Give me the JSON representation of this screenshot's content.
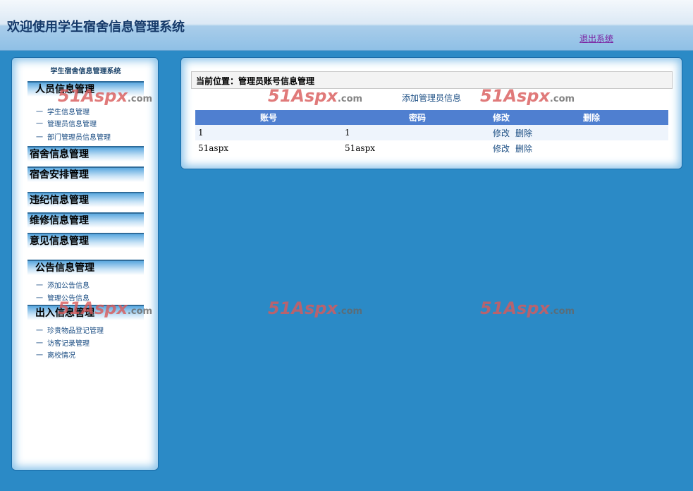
{
  "header": {
    "title": "欢迎使用学生宿舍信息管理系统",
    "logout": "退出系统"
  },
  "sidebar": {
    "title": "学生宿舍信息管理系统",
    "groups": [
      {
        "label": "人员信息管理",
        "items": [
          "学生信息管理",
          "管理员信息管理",
          "部门管理员信息管理"
        ]
      },
      {
        "label": "宿舍信息管理"
      },
      {
        "label": "宿舍安排管理"
      },
      {
        "label": "违纪信息管理"
      },
      {
        "label": "维修信息管理"
      },
      {
        "label": "意见信息管理"
      },
      {
        "label": "公告信息管理",
        "items": [
          "添加公告信息",
          "管理公告信息"
        ]
      },
      {
        "label": "出入信息管理",
        "items": [
          "珍贵物品登记管理",
          "访客记录管理",
          "离校情况"
        ]
      }
    ],
    "dash": "一"
  },
  "main": {
    "breadcrumb": "当前位置：管理员账号信息管理",
    "add_link": "添加管理员信息",
    "table": {
      "headers": [
        "账号",
        "密码",
        "修改",
        "删除"
      ],
      "rows": [
        {
          "account": "1",
          "password": "1",
          "edit": "修改",
          "delete": "删除"
        },
        {
          "account": "51aspx",
          "password": "51aspx",
          "edit": "修改",
          "delete": "删除"
        }
      ]
    }
  },
  "watermark": {
    "main": "51Aspx",
    "suffix": ".com"
  }
}
